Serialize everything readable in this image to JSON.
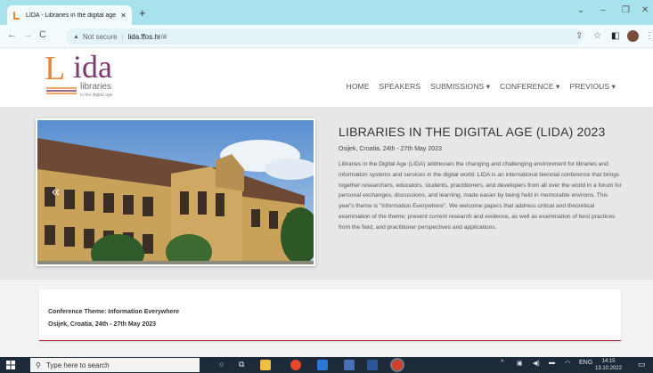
{
  "browser": {
    "tab_title": "LIDA - Libraries in the digital age",
    "tab_close": "✕",
    "new_tab": "+",
    "security_label": "Not secure",
    "url_host": "lida.ffos.hr",
    "url_path": "/#",
    "icons": [
      "back-arrow-icon",
      "forward-arrow-icon",
      "reload-icon",
      "warning-icon",
      "share-icon",
      "star-icon",
      "sidebar-icon",
      "profile-avatar",
      "menu-dots-icon"
    ]
  },
  "site": {
    "logo_main": "ida",
    "logo_initial": "L",
    "logo_sub1": "libraries",
    "logo_sub2": "in the digital age",
    "nav": [
      "HOME",
      "SPEAKERS",
      "SUBMISSIONS ▾",
      "CONFERENCE ▾",
      "PREVIOUS ▾"
    ]
  },
  "hero": {
    "carousel_prev": "«",
    "title": "LIBRARIES IN THE DIGITAL AGE (LIDA) 2023",
    "date": "Osijek, Croatia, 24th - 27th May 2023",
    "description": "Libraries in the Digital Age (LIDA) addresses the changing and challenging environment for libraries and information systems and services in the digital world. LIDA is an international biennial conference that brings together researchers, educators, students, practitioners, and developers from all over the world in a forum for personal exchanges, discussions, and learning, made easier by being held in memorable environs. This year's theme is \"Information Everywhere\". We welcome papers that address critical and theoretical examination of the theme; present current research and evidence, as well as examination of best practices from the field, and practitioner perspectives and applications."
  },
  "theme": {
    "line1": "Conference Theme: Information Everywhere",
    "line2": "Osijek, Croatia, 24th - 27th May 2023"
  },
  "taskbar": {
    "search_placeholder": "Type here to search",
    "language": "ENG",
    "time": "14:15",
    "date": "13.10.2022"
  },
  "colors": {
    "tabstrip": "#a8e2ec",
    "logo_purple": "#7a3a6c",
    "logo_orange": "#e8883a",
    "divider_red": "#b5303e",
    "taskbar": "#1d2a3a"
  }
}
